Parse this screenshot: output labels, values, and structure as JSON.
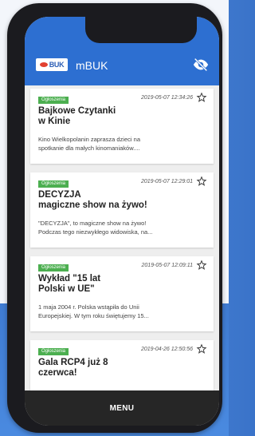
{
  "app": {
    "title": "mBUK",
    "logo_text": "BUK"
  },
  "menu": {
    "label": "MENU"
  },
  "news": [
    {
      "category": "Ogłoszenia",
      "date": "2019-05-07 12:34:26",
      "title_line1": "Bajkowe Czytanki",
      "title_line2": "w Kinie",
      "excerpt_line1": "Kino Wielkopolanin zaprasza dzieci na",
      "excerpt_line2": "spotkanie dla małych kinomaniaków...."
    },
    {
      "category": "Ogłoszenia",
      "date": "2019-05-07 12:29:01",
      "title_line1": "DECYZJA",
      "title_line2": "magiczne show na żywo!",
      "excerpt_line1": "\"DECYZJA\", to magiczne show na żywo!",
      "excerpt_line2": "Podczas tego niezwykłego widowiska, na..."
    },
    {
      "category": "Ogłoszenia",
      "date": "2019-05-07 12:09:11",
      "title_line1": "Wykład \"15 lat",
      "title_line2": "Polski w UE\"",
      "excerpt_line1": "1 maja 2004 r. Polska wstąpiła do Unii",
      "excerpt_line2": "Europejskiej. W tym roku świętujemy 15..."
    },
    {
      "category": "Ogłoszenia",
      "date": "2019-04-26 12:50:56",
      "title_line1": "Gala RCP4 już 8",
      "title_line2": "czerwca!"
    }
  ],
  "colors": {
    "appbar": "#2d6fd1",
    "tag": "#4caf50",
    "menubar": "#262626"
  }
}
